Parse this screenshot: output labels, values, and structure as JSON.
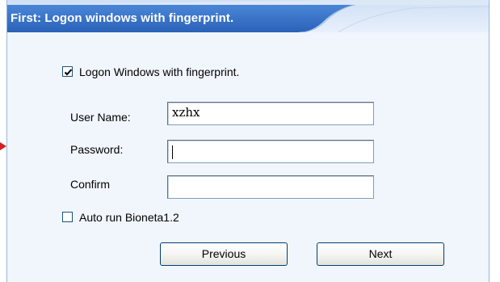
{
  "dialog": {
    "title": "First: Logon windows with fingerprint."
  },
  "logon_checkbox": {
    "label": "Logon Windows with fingerprint.",
    "checked": true
  },
  "fields": {
    "user_name_label": "User Name:",
    "user_name_value": "xzhx",
    "password_label": "Password:",
    "password_value": "",
    "confirm_label": "Confirm",
    "confirm_value": ""
  },
  "autorun_checkbox": {
    "label": "Auto run Bioneta1.2",
    "checked": false
  },
  "buttons": {
    "previous": "Previous",
    "next": "Next"
  },
  "colors": {
    "title_bar": "#2f6fc8",
    "panel_background": "#f1f6fd",
    "pointer_arrow": "#d02020"
  },
  "icons": {
    "pointer": "red-arrow-icon",
    "check": "checkmark-icon"
  }
}
